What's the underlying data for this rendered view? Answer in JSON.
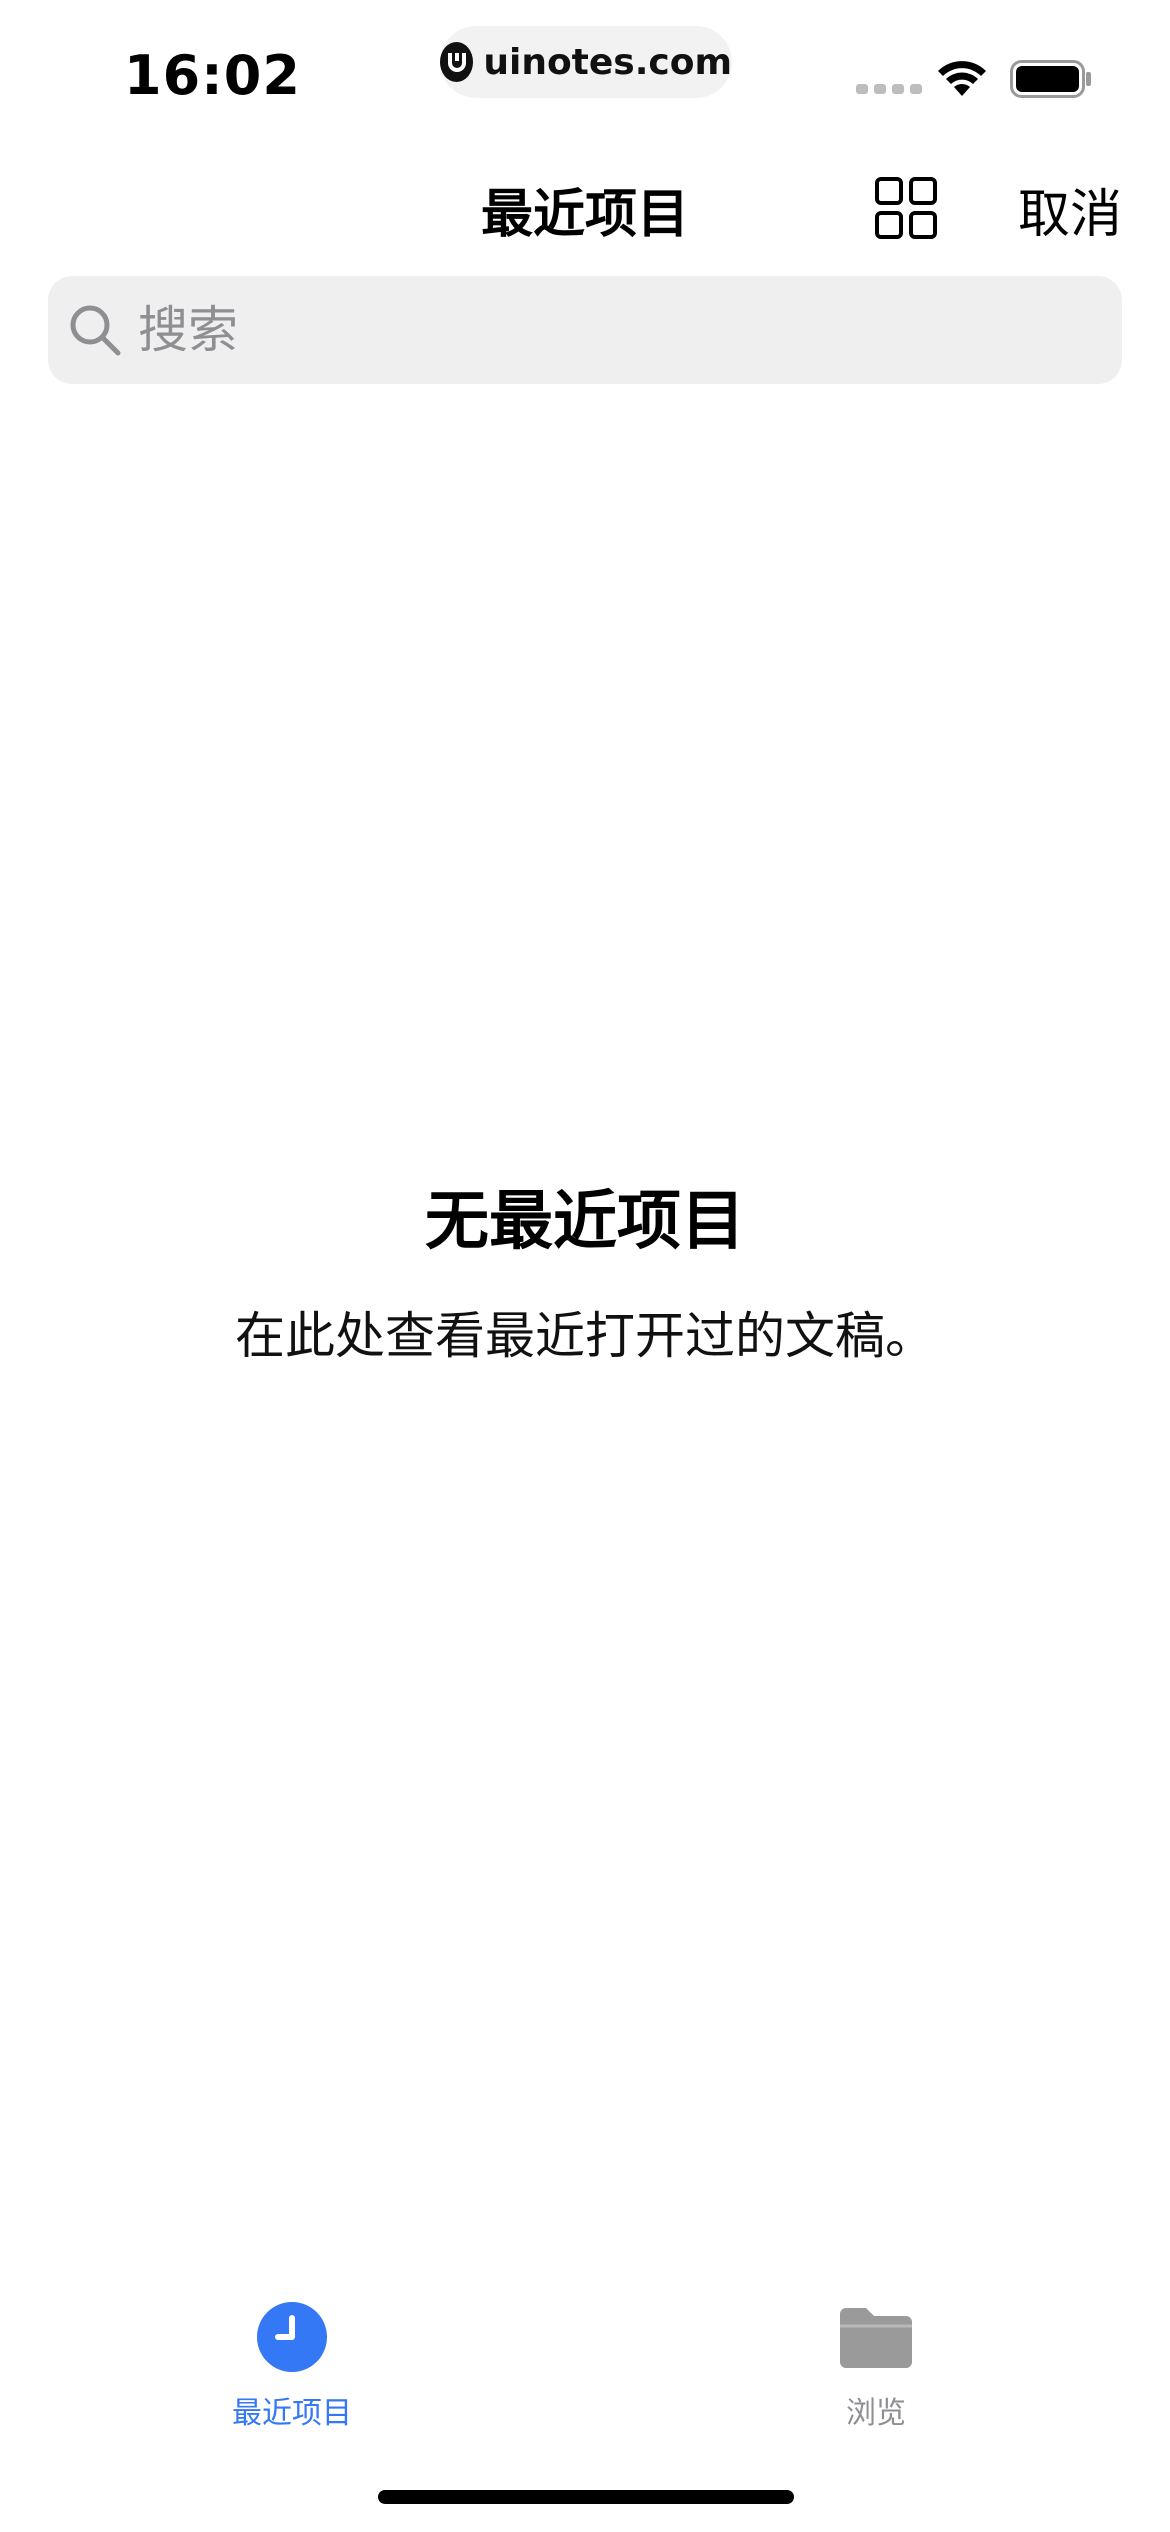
{
  "status_bar": {
    "time": "16:02",
    "url": "uinotes.com"
  },
  "nav": {
    "title": "最近项目",
    "cancel_label": "取消",
    "grid_icon": "grid-view-icon"
  },
  "search": {
    "placeholder": "搜索",
    "value": ""
  },
  "empty_state": {
    "title": "无最近项目",
    "message": "在此处查看最近打开过的文稿。"
  },
  "tab_bar": {
    "tabs": [
      {
        "label": "最近项目",
        "icon": "clock-icon",
        "selected": true
      },
      {
        "label": "浏览",
        "icon": "folder-icon",
        "selected": false
      }
    ]
  },
  "colors": {
    "accent": "#3478f6",
    "inactive": "#8e8e93",
    "search_bg": "#efefef"
  }
}
